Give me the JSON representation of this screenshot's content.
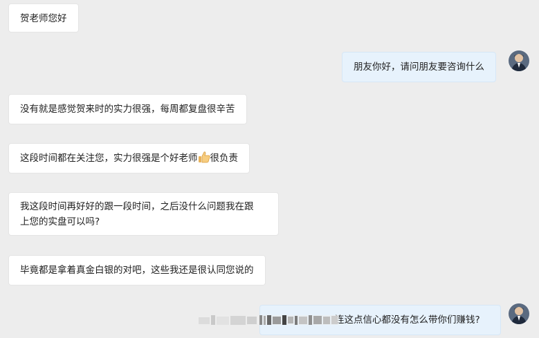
{
  "messages": [
    {
      "side": "left",
      "text": "贺老师您好"
    },
    {
      "side": "right",
      "text": "朋友你好，请问朋友要咨询什么"
    },
    {
      "side": "left",
      "text": "没有就是感觉贺来时的实力很强，每周都复盘很辛苦"
    },
    {
      "side": "left",
      "text_before": "这段时间都在关注您，实力很强是个好老师",
      "emoji": "thumbs-up",
      "text_after": "很负责"
    },
    {
      "side": "left",
      "line1": "我这段时间再好好的跟一段时间，之后没什么问题我在跟",
      "line2": "上您的实盘可以吗?"
    },
    {
      "side": "left",
      "text": "毕竟都是拿着真金白银的对吧，这些我还是很认同您说的"
    },
    {
      "side": "right",
      "visible_text": "连这点信心都没有怎么带你们赚钱?"
    }
  ],
  "colors": {
    "background": "#ededed",
    "left_bubble": "#ffffff",
    "right_bubble": "#e7f2fc",
    "badge": "#f5a623"
  }
}
